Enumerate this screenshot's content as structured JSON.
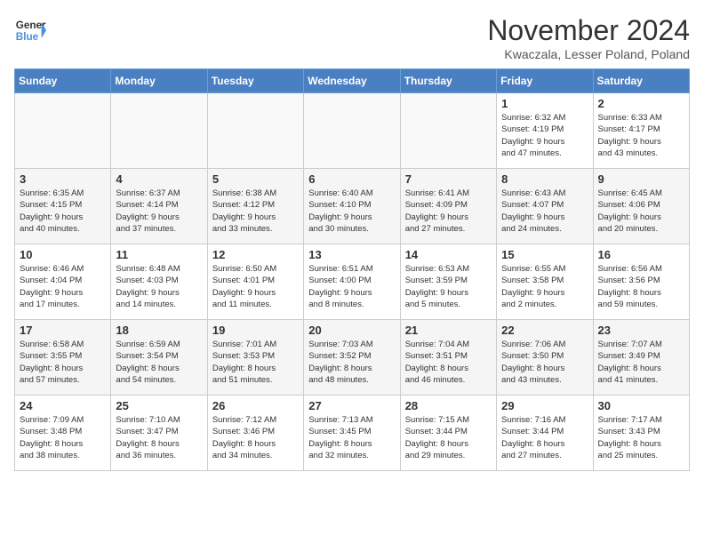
{
  "header": {
    "logo_line1": "General",
    "logo_line2": "Blue",
    "month_title": "November 2024",
    "location": "Kwaczala, Lesser Poland, Poland"
  },
  "days_of_week": [
    "Sunday",
    "Monday",
    "Tuesday",
    "Wednesday",
    "Thursday",
    "Friday",
    "Saturday"
  ],
  "weeks": [
    [
      {
        "day": "",
        "info": ""
      },
      {
        "day": "",
        "info": ""
      },
      {
        "day": "",
        "info": ""
      },
      {
        "day": "",
        "info": ""
      },
      {
        "day": "",
        "info": ""
      },
      {
        "day": "1",
        "info": "Sunrise: 6:32 AM\nSunset: 4:19 PM\nDaylight: 9 hours\nand 47 minutes."
      },
      {
        "day": "2",
        "info": "Sunrise: 6:33 AM\nSunset: 4:17 PM\nDaylight: 9 hours\nand 43 minutes."
      }
    ],
    [
      {
        "day": "3",
        "info": "Sunrise: 6:35 AM\nSunset: 4:15 PM\nDaylight: 9 hours\nand 40 minutes."
      },
      {
        "day": "4",
        "info": "Sunrise: 6:37 AM\nSunset: 4:14 PM\nDaylight: 9 hours\nand 37 minutes."
      },
      {
        "day": "5",
        "info": "Sunrise: 6:38 AM\nSunset: 4:12 PM\nDaylight: 9 hours\nand 33 minutes."
      },
      {
        "day": "6",
        "info": "Sunrise: 6:40 AM\nSunset: 4:10 PM\nDaylight: 9 hours\nand 30 minutes."
      },
      {
        "day": "7",
        "info": "Sunrise: 6:41 AM\nSunset: 4:09 PM\nDaylight: 9 hours\nand 27 minutes."
      },
      {
        "day": "8",
        "info": "Sunrise: 6:43 AM\nSunset: 4:07 PM\nDaylight: 9 hours\nand 24 minutes."
      },
      {
        "day": "9",
        "info": "Sunrise: 6:45 AM\nSunset: 4:06 PM\nDaylight: 9 hours\nand 20 minutes."
      }
    ],
    [
      {
        "day": "10",
        "info": "Sunrise: 6:46 AM\nSunset: 4:04 PM\nDaylight: 9 hours\nand 17 minutes."
      },
      {
        "day": "11",
        "info": "Sunrise: 6:48 AM\nSunset: 4:03 PM\nDaylight: 9 hours\nand 14 minutes."
      },
      {
        "day": "12",
        "info": "Sunrise: 6:50 AM\nSunset: 4:01 PM\nDaylight: 9 hours\nand 11 minutes."
      },
      {
        "day": "13",
        "info": "Sunrise: 6:51 AM\nSunset: 4:00 PM\nDaylight: 9 hours\nand 8 minutes."
      },
      {
        "day": "14",
        "info": "Sunrise: 6:53 AM\nSunset: 3:59 PM\nDaylight: 9 hours\nand 5 minutes."
      },
      {
        "day": "15",
        "info": "Sunrise: 6:55 AM\nSunset: 3:58 PM\nDaylight: 9 hours\nand 2 minutes."
      },
      {
        "day": "16",
        "info": "Sunrise: 6:56 AM\nSunset: 3:56 PM\nDaylight: 8 hours\nand 59 minutes."
      }
    ],
    [
      {
        "day": "17",
        "info": "Sunrise: 6:58 AM\nSunset: 3:55 PM\nDaylight: 8 hours\nand 57 minutes."
      },
      {
        "day": "18",
        "info": "Sunrise: 6:59 AM\nSunset: 3:54 PM\nDaylight: 8 hours\nand 54 minutes."
      },
      {
        "day": "19",
        "info": "Sunrise: 7:01 AM\nSunset: 3:53 PM\nDaylight: 8 hours\nand 51 minutes."
      },
      {
        "day": "20",
        "info": "Sunrise: 7:03 AM\nSunset: 3:52 PM\nDaylight: 8 hours\nand 48 minutes."
      },
      {
        "day": "21",
        "info": "Sunrise: 7:04 AM\nSunset: 3:51 PM\nDaylight: 8 hours\nand 46 minutes."
      },
      {
        "day": "22",
        "info": "Sunrise: 7:06 AM\nSunset: 3:50 PM\nDaylight: 8 hours\nand 43 minutes."
      },
      {
        "day": "23",
        "info": "Sunrise: 7:07 AM\nSunset: 3:49 PM\nDaylight: 8 hours\nand 41 minutes."
      }
    ],
    [
      {
        "day": "24",
        "info": "Sunrise: 7:09 AM\nSunset: 3:48 PM\nDaylight: 8 hours\nand 38 minutes."
      },
      {
        "day": "25",
        "info": "Sunrise: 7:10 AM\nSunset: 3:47 PM\nDaylight: 8 hours\nand 36 minutes."
      },
      {
        "day": "26",
        "info": "Sunrise: 7:12 AM\nSunset: 3:46 PM\nDaylight: 8 hours\nand 34 minutes."
      },
      {
        "day": "27",
        "info": "Sunrise: 7:13 AM\nSunset: 3:45 PM\nDaylight: 8 hours\nand 32 minutes."
      },
      {
        "day": "28",
        "info": "Sunrise: 7:15 AM\nSunset: 3:44 PM\nDaylight: 8 hours\nand 29 minutes."
      },
      {
        "day": "29",
        "info": "Sunrise: 7:16 AM\nSunset: 3:44 PM\nDaylight: 8 hours\nand 27 minutes."
      },
      {
        "day": "30",
        "info": "Sunrise: 7:17 AM\nSunset: 3:43 PM\nDaylight: 8 hours\nand 25 minutes."
      }
    ]
  ]
}
